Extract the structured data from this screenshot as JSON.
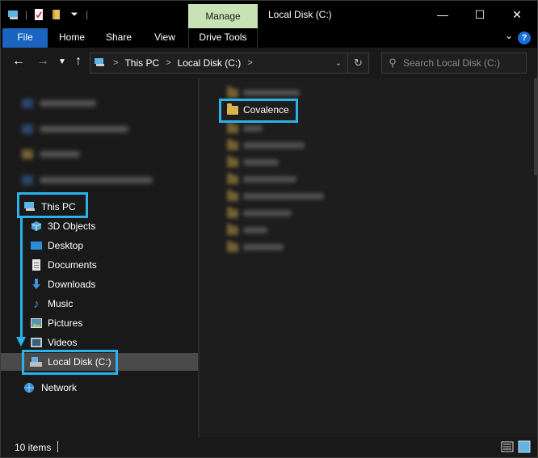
{
  "window": {
    "title": "Local Disk (C:)",
    "contextual_tab": "Manage",
    "controls": {
      "minimize": "—",
      "maximize": "☐",
      "close": "✕"
    }
  },
  "ribbon": {
    "tabs": [
      "File",
      "Home",
      "Share",
      "View",
      "Drive Tools"
    ],
    "help": "?",
    "collapse_chevron": "⌄"
  },
  "address": {
    "breadcrumbs": [
      "This PC",
      "Local Disk (C:)"
    ],
    "separator": ">",
    "search_placeholder": "Search Local Disk (C:)"
  },
  "nav_pane": {
    "this_pc": "This PC",
    "items": [
      "3D Objects",
      "Desktop",
      "Documents",
      "Downloads",
      "Music",
      "Pictures",
      "Videos",
      "Local Disk (C:)"
    ],
    "network": "Network",
    "selected": "Local Disk (C:)"
  },
  "content": {
    "highlighted_folder": "Covalence"
  },
  "status": {
    "item_count": "10 items"
  },
  "colors": {
    "accent_highlight": "#2ab3e8",
    "file_tab": "#1a64c0",
    "manage_tab": "#c7e3b6",
    "folder": "#d9b44a"
  }
}
